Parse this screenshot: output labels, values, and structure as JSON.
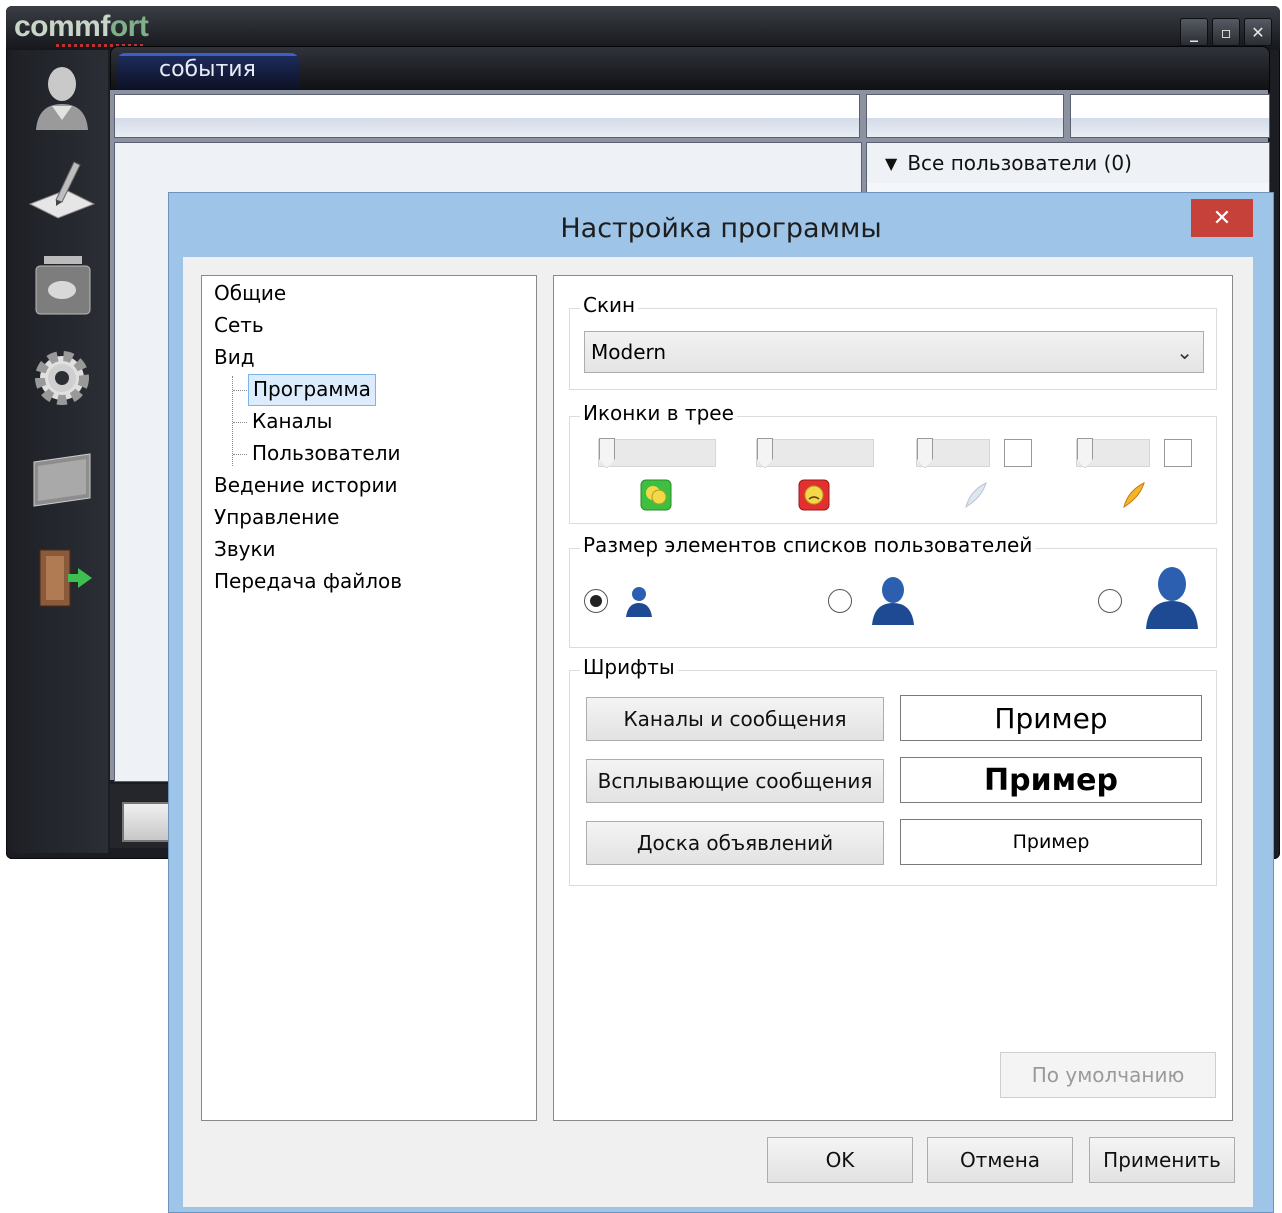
{
  "app": {
    "logo_part1": "commf",
    "logo_part2": "ort",
    "window_buttons": [
      "_",
      "▫",
      "✕"
    ],
    "active_tab": "события",
    "users_header": "Все пользователи (0)"
  },
  "dialog": {
    "title": "Настройка программы",
    "close_label": "✕",
    "tree": {
      "items": [
        {
          "label": "Общие"
        },
        {
          "label": "Сеть"
        },
        {
          "label": "Вид"
        },
        {
          "label": "Программа",
          "selected": true,
          "child": true
        },
        {
          "label": "Каналы",
          "child": true
        },
        {
          "label": "Пользователи",
          "child": true
        },
        {
          "label": "Ведение истории"
        },
        {
          "label": "Управление"
        },
        {
          "label": "Звуки"
        },
        {
          "label": "Передача файлов"
        }
      ]
    },
    "skin": {
      "label": "Скин",
      "value": "Modern"
    },
    "tree_icons": {
      "label": "Иконки в трее"
    },
    "list_size": {
      "label": "Размер элементов списков пользователей",
      "selected_index": 0
    },
    "fonts": {
      "label": "Шрифты",
      "buttons": [
        "Каналы и сообщения",
        "Всплывающие сообщения",
        "Доска объявлений"
      ],
      "preview_text": "Пример"
    },
    "defaults_button": "По умолчанию",
    "ok_button": "OK",
    "cancel_button": "Отмена",
    "apply_button": "Применить"
  },
  "colors": {
    "dialog_frame": "#9ec4e8",
    "close_button": "#c7413b",
    "tree_selection": "#dcecfc"
  }
}
